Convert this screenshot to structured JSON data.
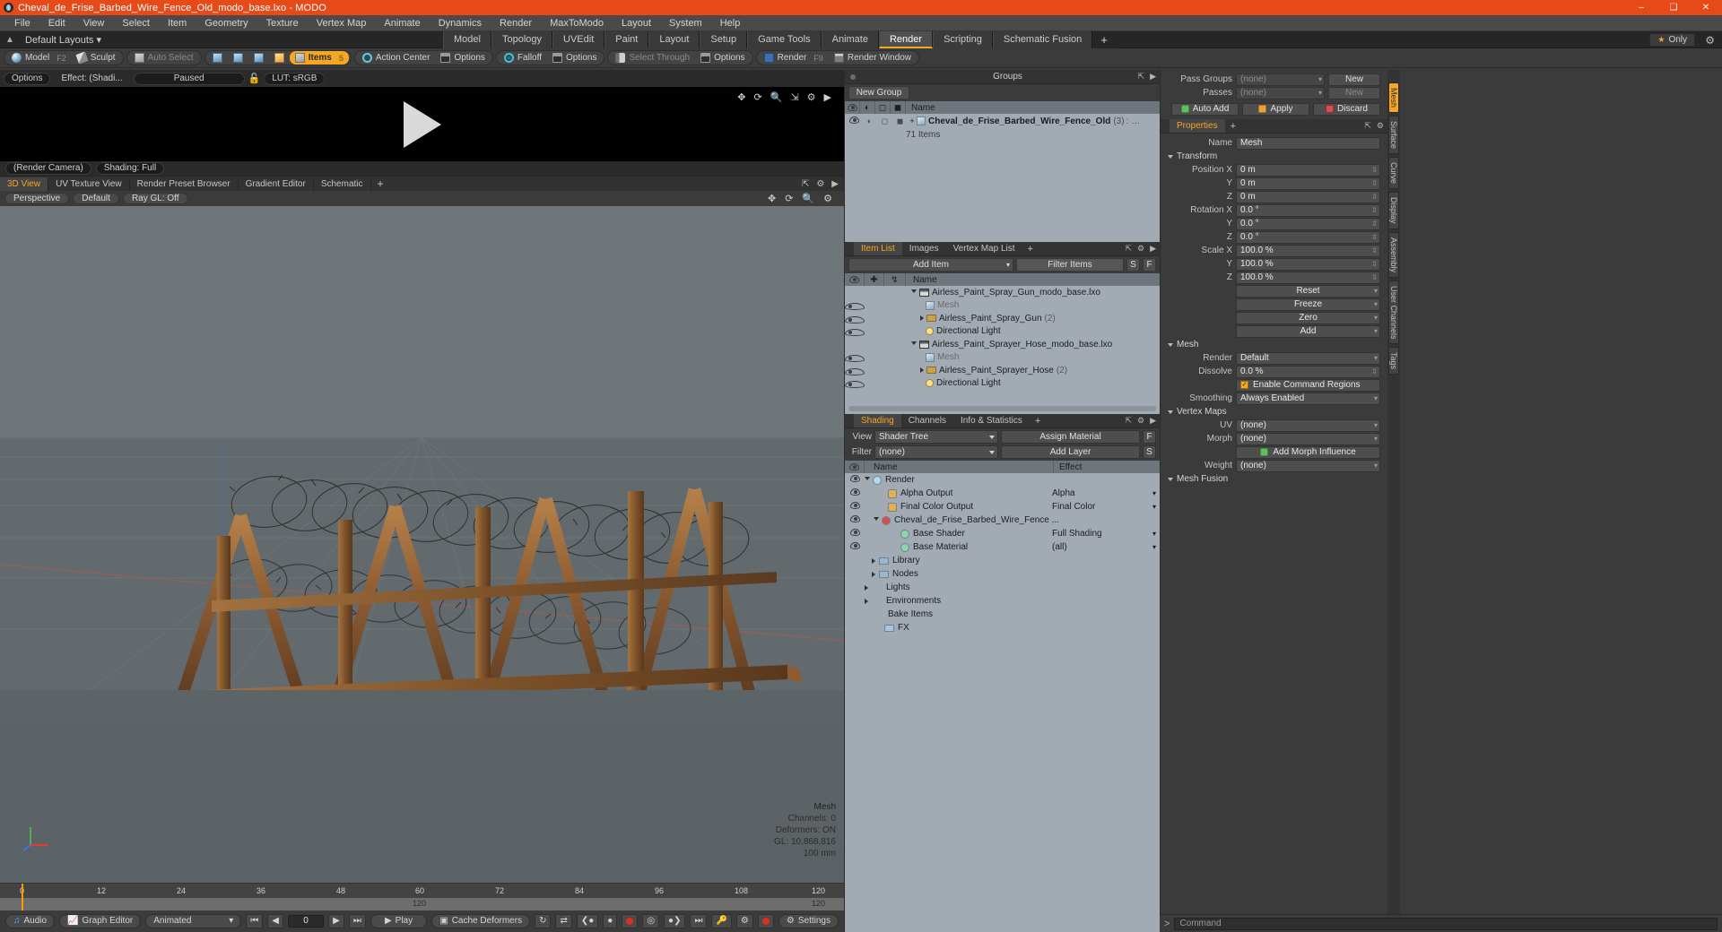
{
  "window": {
    "title": "Cheval_de_Frise_Barbed_Wire_Fence_Old_modo_base.lxo - MODO",
    "minimize": "–",
    "maximize": "❑",
    "close": "✕"
  },
  "menu": [
    "File",
    "Edit",
    "View",
    "Select",
    "Item",
    "Geometry",
    "Texture",
    "Vertex Map",
    "Animate",
    "Dynamics",
    "Render",
    "MaxToModo",
    "Layout",
    "System",
    "Help"
  ],
  "layout_row": {
    "default_layouts": "Default Layouts",
    "tabs": [
      {
        "label": "Model",
        "active": false
      },
      {
        "label": "Topology",
        "active": false
      },
      {
        "label": "UVEdit",
        "active": false
      },
      {
        "label": "Paint",
        "active": false
      },
      {
        "label": "Layout",
        "active": false
      },
      {
        "label": "Setup",
        "active": false
      },
      {
        "label": "Game Tools",
        "active": false
      },
      {
        "label": "Animate",
        "active": false
      },
      {
        "label": "Render",
        "active": true
      },
      {
        "label": "Scripting",
        "active": false
      },
      {
        "label": "Schematic Fusion",
        "active": false
      }
    ],
    "add_tab": "+",
    "only_label": "Only",
    "star": "★"
  },
  "modebar": {
    "model": "Model",
    "model_key": "F2",
    "sculpt": "Sculpt",
    "auto_select": "Auto Select",
    "items": "Items",
    "items_key": "5",
    "action_center": "Action Center",
    "options_1": "Options",
    "falloff": "Falloff",
    "options_2": "Options",
    "select_through": "Select Through",
    "options_3": "Options",
    "render": "Render",
    "render_key": "F9",
    "render_window": "Render Window"
  },
  "preview": {
    "options": "Options",
    "effect": "Effect: (Shadi...",
    "paused": "Paused",
    "lut": "LUT: sRGB",
    "render_camera": "(Render Camera)",
    "shading": "Shading: Full"
  },
  "viewport": {
    "tabs": [
      {
        "label": "3D View",
        "active": true
      },
      {
        "label": "UV Texture View",
        "active": false
      },
      {
        "label": "Render Preset Browser",
        "active": false
      },
      {
        "label": "Gradient Editor",
        "active": false
      },
      {
        "label": "Schematic",
        "active": false
      }
    ],
    "add_tab": "+",
    "buttons": [
      "Perspective",
      "Default",
      "Ray GL: Off"
    ],
    "hud": {
      "title": "Mesh",
      "channels": "Channels: 0",
      "deformers": "Deformers: ON",
      "gl": "GL: 10,868,816",
      "scale": "100 mm"
    }
  },
  "timeline": {
    "ticks": [
      "0",
      "12",
      "24",
      "36",
      "48",
      "60",
      "72",
      "84",
      "96",
      "108",
      "120"
    ],
    "range_label": "120",
    "end_label": "120"
  },
  "bottombar": {
    "audio": "Audio",
    "graph_editor": "Graph Editor",
    "animated": "Animated",
    "frame": "0",
    "play": "Play",
    "cache_deformers": "Cache Deformers",
    "settings": "Settings"
  },
  "groups_panel": {
    "title": "Groups",
    "new_group": "New Group",
    "columns": [
      "Name"
    ],
    "rows": [
      {
        "name": "Cheval_de_Frise_Barbed_Wire_Fence_Old",
        "count": "(3)",
        "suffix": ":",
        "more": "...",
        "sub": "71 Items"
      }
    ]
  },
  "item_list_panel": {
    "tabs": [
      {
        "label": "Item List",
        "active": true
      },
      {
        "label": "Images",
        "active": false
      },
      {
        "label": "Vertex Map List",
        "active": false
      }
    ],
    "add_tab": "+",
    "add_item": "Add Item",
    "filter_placeholder": "Filter Items",
    "filter_s": "S",
    "filter_f": "F",
    "columns": [
      "Name"
    ],
    "rows": [
      {
        "name": "Airless_Paint_Spray_Gun_modo_base.lxo",
        "icon": "scene-icon",
        "indent": 0,
        "twisty": "open",
        "dim": false
      },
      {
        "name": "Mesh",
        "icon": "mesh-icon",
        "indent": 1,
        "twisty": "none",
        "dim": true
      },
      {
        "name": "Airless_Paint_Spray_Gun",
        "count": "(2)",
        "icon": "folder-icon",
        "indent": 1,
        "twisty": "closed",
        "dim": false
      },
      {
        "name": "Directional Light",
        "icon": "light-icon",
        "indent": 1,
        "twisty": "none",
        "dim": false
      },
      {
        "name": "Airless_Paint_Sprayer_Hose_modo_base.lxo",
        "icon": "scene-icon",
        "indent": 0,
        "twisty": "open",
        "dim": false
      },
      {
        "name": "Mesh",
        "icon": "mesh-icon",
        "indent": 1,
        "twisty": "none",
        "dim": true
      },
      {
        "name": "Airless_Paint_Sprayer_Hose",
        "count": "(2)",
        "icon": "folder-icon",
        "indent": 1,
        "twisty": "closed",
        "dim": false
      },
      {
        "name": "Directional Light",
        "icon": "light-icon",
        "indent": 1,
        "twisty": "none",
        "dim": false
      }
    ]
  },
  "shading_panel": {
    "tabs": [
      {
        "label": "Shading",
        "active": true
      },
      {
        "label": "Channels",
        "active": false
      },
      {
        "label": "Info & Statistics",
        "active": false
      }
    ],
    "add_tab": "+",
    "view_label": "View",
    "view_value": "Shader Tree",
    "assign_material": "Assign Material",
    "assign_f": "F",
    "filter_label": "Filter",
    "filter_value": "(none)",
    "add_layer": "Add Layer",
    "add_layer_s": "S",
    "columns": [
      "Name",
      "Effect"
    ],
    "rows": [
      {
        "name": "Render",
        "effect": "",
        "icon": "render-icon",
        "indent": 0,
        "twisty": "open"
      },
      {
        "name": "Alpha Output",
        "effect": "Alpha",
        "icon": "output-icon",
        "indent": 1,
        "twisty": "none"
      },
      {
        "name": "Final Color Output",
        "effect": "Final Color",
        "icon": "output-icon",
        "indent": 1,
        "twisty": "none"
      },
      {
        "name": "Cheval_de_Frise_Barbed_Wire_Fence ...",
        "effect": "",
        "icon": "material-icon",
        "indent": 1,
        "twisty": "open"
      },
      {
        "name": "Base Shader",
        "effect": "Full Shading",
        "icon": "shader-icon",
        "indent": 2,
        "twisty": "none"
      },
      {
        "name": "Base Material",
        "effect": "(all)",
        "icon": "shader-icon",
        "indent": 2,
        "twisty": "none"
      },
      {
        "name": "Library",
        "effect": "",
        "icon": "library-icon",
        "indent": 1,
        "twisty": "closed"
      },
      {
        "name": "Nodes",
        "effect": "",
        "icon": "nodes-icon",
        "indent": 1,
        "twisty": "closed"
      },
      {
        "name": "Lights",
        "effect": "",
        "icon": "none",
        "indent": 0,
        "twisty": "closed"
      },
      {
        "name": "Environments",
        "effect": "",
        "icon": "none",
        "indent": 0,
        "twisty": "closed"
      },
      {
        "name": "Bake Items",
        "effect": "",
        "icon": "none",
        "indent": 0,
        "twisty": "none"
      },
      {
        "name": "FX",
        "effect": "",
        "icon": "fx-icon",
        "indent": 0,
        "twisty": "none"
      }
    ]
  },
  "properties": {
    "pass_groups_label": "Pass Groups",
    "pass_groups_value": "(none)",
    "new_button": "New",
    "passes_label": "Passes",
    "passes_value": "(none)",
    "new_button_2": "New",
    "auto_add": "Auto Add",
    "apply": "Apply",
    "discard": "Discard",
    "panel_title": "Properties",
    "panel_plus": "+",
    "name_label": "Name",
    "name_value": "Mesh",
    "transform_header": "Transform",
    "position_label": "Position X",
    "position_y_label": "Y",
    "position_z_label": "Z",
    "position": [
      "0 m",
      "0 m",
      "0 m"
    ],
    "rotation_label": "Rotation X",
    "rotation_y_label": "Y",
    "rotation_z_label": "Z",
    "rotation": [
      "0.0 °",
      "0.0 °",
      "0.0 °"
    ],
    "scale_label": "Scale X",
    "scale_y_label": "Y",
    "scale_z_label": "Z",
    "scale": [
      "100.0 %",
      "100.0 %",
      "100.0 %"
    ],
    "reset": "Reset",
    "freeze": "Freeze",
    "zero": "Zero",
    "add": "Add",
    "mesh_header": "Mesh",
    "render_label": "Render",
    "render_value": "Default",
    "dissolve_label": "Dissolve",
    "dissolve_value": "0.0 %",
    "enable_command_regions": "Enable Command Regions",
    "smoothing_label": "Smoothing",
    "smoothing_value": "Always Enabled",
    "vertex_maps_header": "Vertex Maps",
    "uv_label": "UV",
    "uv_value": "(none)",
    "morph_label": "Morph",
    "morph_value": "(none)",
    "add_morph_influence": "Add Morph Influence",
    "weight_label": "Weight",
    "weight_value": "(none)",
    "mesh_fusion_header": "Mesh Fusion",
    "vertical_tabs": [
      {
        "label": "Mesh",
        "active": true
      },
      {
        "label": "Surface",
        "active": false
      },
      {
        "label": "Curve",
        "active": false
      },
      {
        "label": "Display",
        "active": false
      },
      {
        "label": "Assembly",
        "active": false
      },
      {
        "label": "User Channels",
        "active": false
      },
      {
        "label": "Tags",
        "active": false
      }
    ]
  },
  "command_bar": {
    "placeholder": "Command",
    "prefix": ">"
  },
  "colors": {
    "title_bar": "#e64a19",
    "accent": "#f5a623",
    "panel_bg": "#3b3b3b",
    "list_bg": "#a2aab3",
    "viewport_bg": "#6a7175"
  }
}
